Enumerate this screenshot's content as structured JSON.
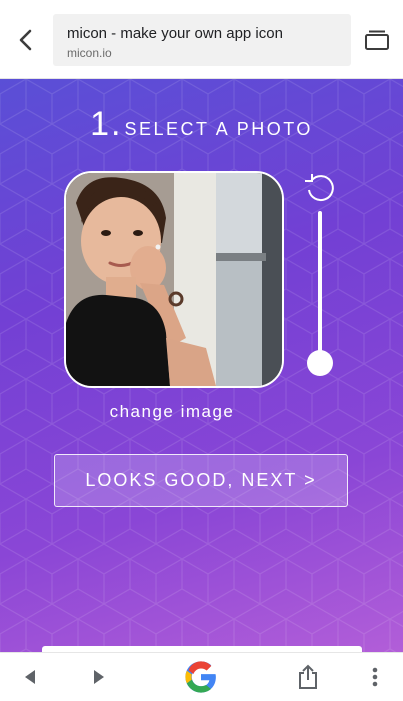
{
  "browser": {
    "page_title": "micon - make your own app icon",
    "domain": "micon.io"
  },
  "step": {
    "number": "1",
    "label": "SELECT A PHOTO"
  },
  "editor": {
    "zoom_level": 0
  },
  "actions": {
    "change_image": "change image",
    "next": "LOOKS GOOD, NEXT >"
  },
  "colors": {
    "gradient_start": "#5a4fd6",
    "gradient_end": "#b25ed8",
    "google_blue": "#4285F4",
    "google_red": "#EA4335",
    "google_yellow": "#FBBC05",
    "google_green": "#34A853"
  },
  "icons": {
    "back": "back-arrow-icon",
    "tabs": "tabs-icon",
    "rotate": "rotate-icon",
    "nav_back": "triangle-left-icon",
    "nav_forward": "triangle-right-icon",
    "home": "google-logo-icon",
    "share": "share-icon",
    "menu": "more-vertical-icon"
  }
}
